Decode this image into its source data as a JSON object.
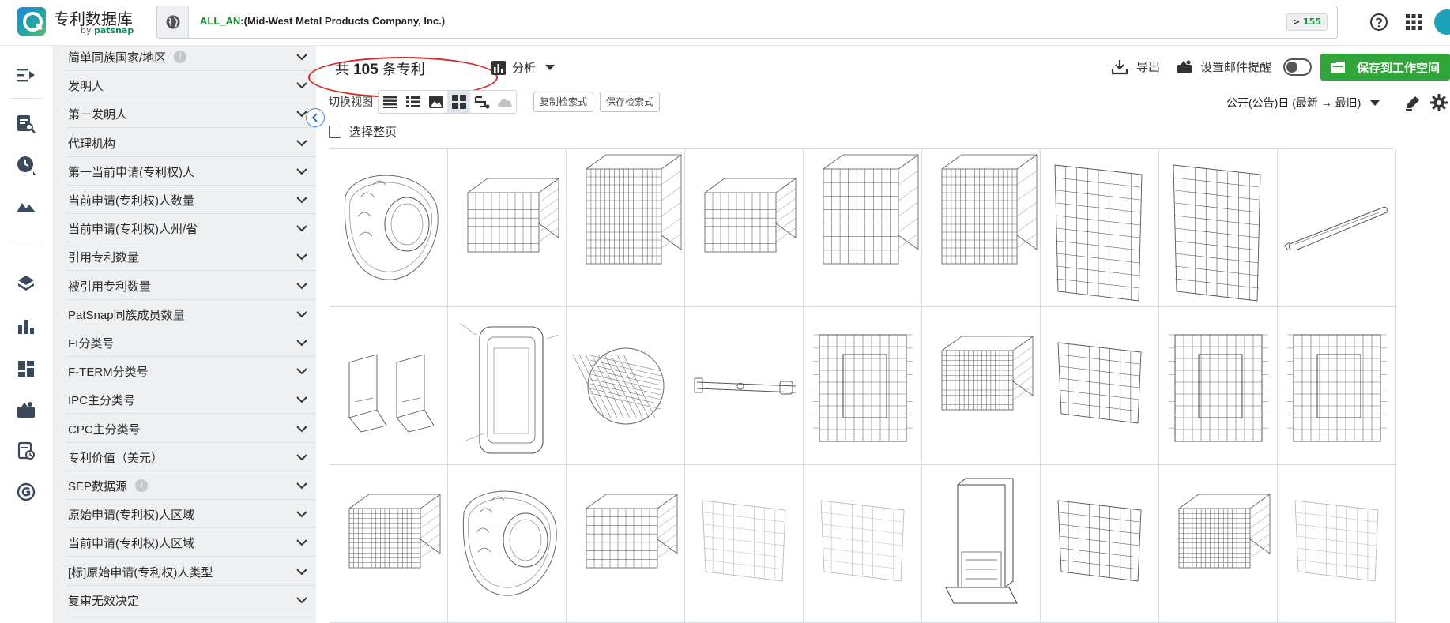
{
  "header": {
    "app_name": "专利数据库",
    "by_prefix": "by ",
    "by_brand": "patsnap",
    "search": {
      "field": "ALL_AN",
      "query_value": ":(Mid-West Metal Products Company, Inc.)"
    },
    "count_badge": {
      "prefix": "> ",
      "value": "155"
    },
    "icons": [
      "help-icon",
      "apps-grid-icon",
      "user-avatar"
    ]
  },
  "rail": {
    "icons": [
      "collapse-menu-icon",
      "search-doc-icon",
      "history-icon",
      "landscape-icon",
      "layers-icon",
      "bar-chart-icon",
      "dashboard-icon",
      "workspace-icon",
      "monitor-doc-icon",
      "g-icon"
    ]
  },
  "filters": [
    {
      "label": "简单同族国家/地区",
      "info": true
    },
    {
      "label": "发明人"
    },
    {
      "label": "第一发明人"
    },
    {
      "label": "代理机构"
    },
    {
      "label": "第一当前申请(专利权)人"
    },
    {
      "label": "当前申请(专利权)人数量"
    },
    {
      "label": "当前申请(专利权)人州/省"
    },
    {
      "label": "引用专利数量"
    },
    {
      "label": "被引用专利数量"
    },
    {
      "label": "PatSnap同族成员数量"
    },
    {
      "label": "FI分类号"
    },
    {
      "label": "F-TERM分类号"
    },
    {
      "label": "IPC主分类号"
    },
    {
      "label": "CPC主分类号"
    },
    {
      "label": "专利价值（美元）"
    },
    {
      "label": "SEP数据源",
      "info": true
    },
    {
      "label": "原始申请(专利权)人区域"
    },
    {
      "label": "当前申请(专利权)人区域"
    },
    {
      "label": "[标]原始申请(专利权)人类型"
    },
    {
      "label": "复审无效决定"
    }
  ],
  "results": {
    "prefix": "共",
    "count": "105",
    "suffix": "条专利",
    "analyze_label": "分析",
    "export_label": "导出",
    "email_alert_label": "设置邮件提醒",
    "email_alert_on": false,
    "save_workspace_label": "保存到工作空间",
    "switch_view_label": "切换视图",
    "copy_query_label": "复制检索式",
    "save_query_label": "保存检索式",
    "sort_label": "公开(公告)日 (最新 → 最旧)",
    "select_page_label": "选择整页"
  },
  "colors": {
    "accent_green": "#2fa53a",
    "query_field_green": "#1a8f3a",
    "annotation_red": "#d42a2a",
    "filter_bg": "#eef0f2"
  },
  "thumbnails": [
    "pet-bed-shell",
    "wire-crate-small",
    "wire-crate-cube",
    "wire-crate-iso",
    "wire-crate-tall",
    "wire-crate-cube",
    "wire-panel",
    "wire-panel",
    "handle-bar",
    "divider-pair",
    "door-frame",
    "wire-detail-circle",
    "latch-rod",
    "crate-front-panel",
    "wire-crate-dense",
    "wire-panel-small",
    "crate-front-panel",
    "crate-front-panel",
    "wire-crate-dense",
    "pet-bed-shell",
    "wire-crate-iso",
    "faint-panel",
    "faint-panel",
    "door-frame-stand",
    "wire-panel-small",
    "wire-crate-dense",
    "faint-panel"
  ]
}
